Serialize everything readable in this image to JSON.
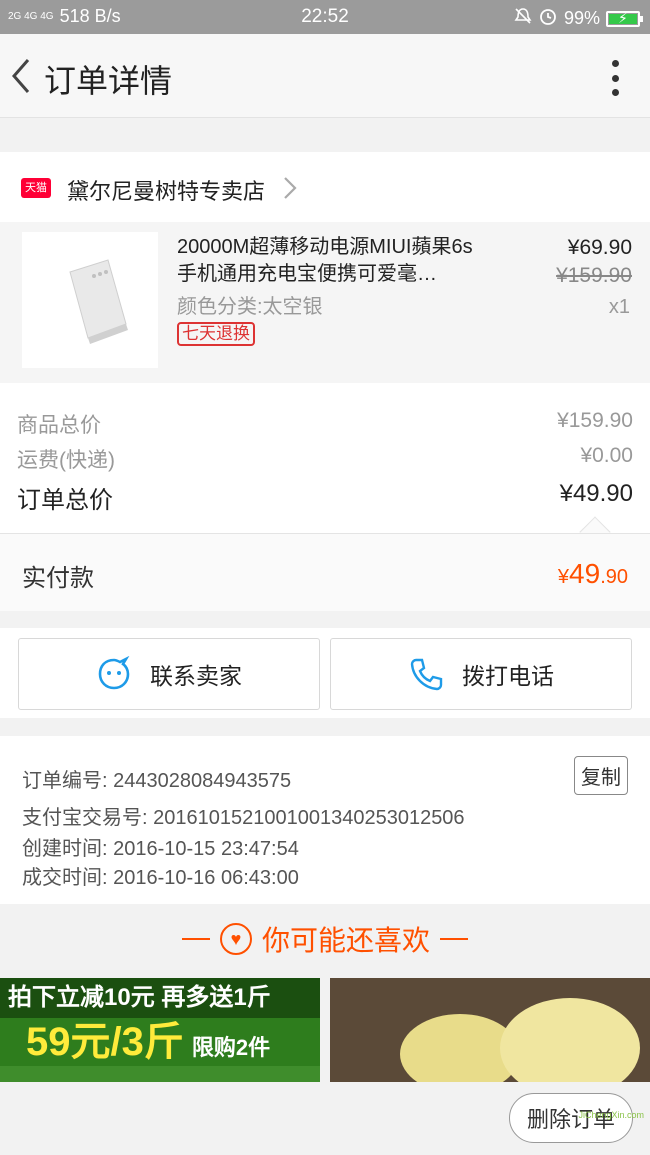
{
  "status_bar": {
    "network_signal": "2G 4G 4G",
    "speed": "518 B/s",
    "time": "22:52",
    "battery_percent": "99%",
    "battery_level": 0.99
  },
  "header": {
    "title": "订单详情"
  },
  "shop": {
    "badge": "天猫",
    "name": "黛尔尼曼树特专卖店"
  },
  "product": {
    "title": "20000M超薄移动电源MIUI蘋果6s手机通用充电宝便携可爱毫…",
    "attribute": "颜色分类:太空银",
    "tag": "七天退换",
    "price": "¥69.90",
    "original_price": "¥159.90",
    "quantity": "x1"
  },
  "totals": {
    "goods_label": "商品总价",
    "goods_value": "¥159.90",
    "shipping_label": "运费(快递)",
    "shipping_value": "¥0.00",
    "order_label": "订单总价",
    "order_value": "¥49.90"
  },
  "paid": {
    "label": "实付款",
    "currency": "¥",
    "integer": "49",
    "decimal": ".90"
  },
  "actions": {
    "contact_label": "联系卖家",
    "call_label": "拨打电话"
  },
  "info": {
    "order_no": "订单编号: 2443028084943575",
    "alipay_no": "支付宝交易号: 2016101521001001340253012506",
    "created": "创建时间: 2016-10-15 23:47:54",
    "completed": "成交时间: 2016-10-16 06:43:00",
    "copy_label": "复制"
  },
  "recommend": {
    "title": "你可能还喜欢"
  },
  "promo": {
    "line1": "拍下立减10元 再多送1斤",
    "line2": "59元/3斤",
    "limit": "限购2件"
  },
  "footer": {
    "delete_label": "删除订单"
  },
  "watermark": "JiChengXin.com",
  "colors": {
    "accent": "#ff5000",
    "tmall_red": "#ff0036",
    "tag_red": "#dd3333"
  }
}
